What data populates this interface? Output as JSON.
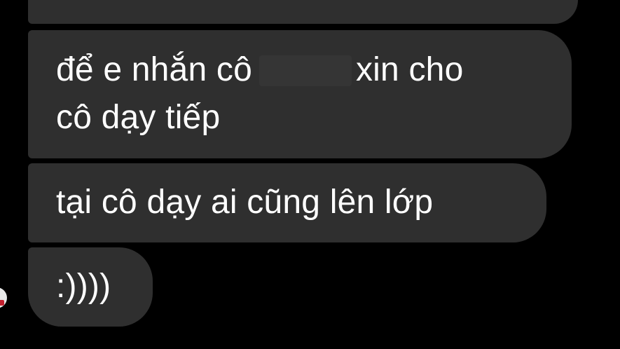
{
  "messages": [
    {
      "lines": [
        ""
      ]
    },
    {
      "line1_before": "để e nhắn cô",
      "line1_after": "xin cho",
      "line2": "cô dạy tiếp"
    },
    {
      "text": "tại cô dạy ai cũng lên lớp"
    },
    {
      "text": ":))))"
    }
  ],
  "colors": {
    "background": "#000000",
    "bubble": "#2f2f2f",
    "text": "#ffffff"
  }
}
